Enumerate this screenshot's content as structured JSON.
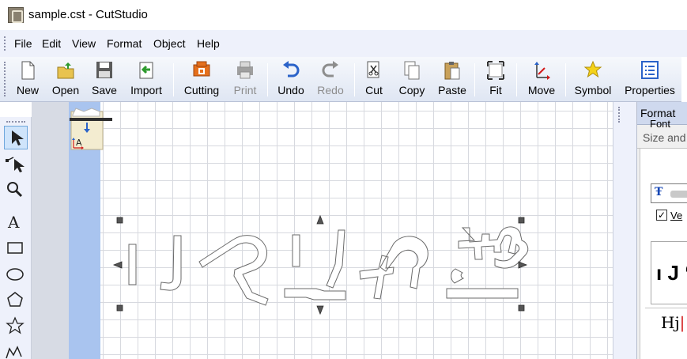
{
  "window": {
    "title": "sample.cst - CutStudio"
  },
  "menu": {
    "items": [
      "File",
      "Edit",
      "View",
      "Format",
      "Object",
      "Help"
    ]
  },
  "toolbar": {
    "buttons": [
      {
        "label": "New",
        "icon": "new-file-icon",
        "enabled": true
      },
      {
        "label": "Open",
        "icon": "open-folder-icon",
        "enabled": true
      },
      {
        "label": "Save",
        "icon": "save-disk-icon",
        "enabled": true
      },
      {
        "label": "Import",
        "icon": "import-icon",
        "enabled": true
      },
      {
        "label": "Cutting",
        "icon": "cutting-printer-icon",
        "enabled": true
      },
      {
        "label": "Print",
        "icon": "printer-icon",
        "enabled": false
      },
      {
        "label": "Undo",
        "icon": "undo-arrow-icon",
        "enabled": true
      },
      {
        "label": "Redo",
        "icon": "redo-arrow-icon",
        "enabled": false
      },
      {
        "label": "Cut",
        "icon": "scissors-icon",
        "enabled": true
      },
      {
        "label": "Copy",
        "icon": "copy-icon",
        "enabled": true
      },
      {
        "label": "Paste",
        "icon": "paste-clipboard-icon",
        "enabled": true
      },
      {
        "label": "Fit",
        "icon": "fit-frame-icon",
        "enabled": true
      },
      {
        "label": "Move",
        "icon": "move-axes-icon",
        "enabled": true
      },
      {
        "label": "Symbol",
        "icon": "star-icon",
        "enabled": true
      },
      {
        "label": "Properties",
        "icon": "properties-list-icon",
        "enabled": true
      }
    ]
  },
  "left_tools": [
    {
      "name": "select-arrow-icon",
      "selected": true
    },
    {
      "name": "edit-points-icon",
      "selected": false
    },
    {
      "name": "zoom-magnifier-icon",
      "selected": false
    },
    {
      "name": "text-tool-icon",
      "selected": false
    },
    {
      "name": "rectangle-tool-icon",
      "selected": false
    },
    {
      "name": "ellipse-tool-icon",
      "selected": false
    },
    {
      "name": "pentagon-tool-icon",
      "selected": false
    },
    {
      "name": "star-tool-icon",
      "selected": false
    },
    {
      "name": "freehand-tool-icon",
      "selected": false
    }
  ],
  "canvas": {
    "cutting_mode_icon": "cutting-direction-icon"
  },
  "format_panel": {
    "title": "Format",
    "tab": "Size and S",
    "font_label": "Font",
    "checkbox_label": "Ve",
    "checkbox_checked": true,
    "preview_text": "ı J ʻ",
    "preview_sample": "Hj"
  },
  "colors": {
    "toolbar_bg": "#dfe6f3",
    "canvas_grid": "#d7d9df",
    "margin_blue": "#a9c4ef",
    "panel_header": "#cfd9ee"
  }
}
